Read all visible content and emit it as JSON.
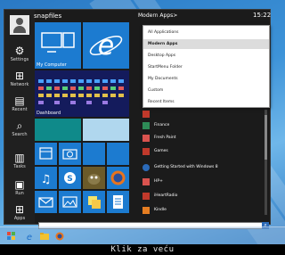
{
  "sidebar": {
    "items": [
      {
        "label": "Settings",
        "icon": "gear-icon"
      },
      {
        "label": "Network",
        "icon": "network-icon"
      },
      {
        "label": "Recent",
        "icon": "recent-icon"
      },
      {
        "label": "Search",
        "icon": "search-icon"
      },
      {
        "label": "Tasks",
        "icon": "tasks-icon"
      },
      {
        "label": "Run",
        "icon": "run-icon"
      },
      {
        "label": "Apps",
        "icon": "apps-icon"
      }
    ]
  },
  "user": {
    "name": "snapfiles"
  },
  "header": {
    "apps_label": "Modern Apps>",
    "clock": "15:22"
  },
  "tiles": {
    "my_computer": "My Computer",
    "dashboard": "Dashboard"
  },
  "dropdown": {
    "items": [
      "All Applications",
      "Modern Apps",
      "Desktop Apps",
      "StartMenu Folder",
      "My Documents",
      "Custom",
      "Recent Items"
    ],
    "selected_index": 1
  },
  "applist": [
    {
      "name": "",
      "color": "#c0392b",
      "icon": "app-icon"
    },
    {
      "name": "Finance",
      "color": "#2e8b57",
      "icon": "finance-icon"
    },
    {
      "name": "Fresh Paint",
      "color": "#d9534f",
      "icon": "fresh-paint-icon"
    },
    {
      "name": "Games",
      "color": "#c0392b",
      "icon": "games-icon"
    },
    {
      "name": "Getting Started with Windows 8",
      "color": "#2b6ab8",
      "icon": "getting-started-icon"
    },
    {
      "name": "HP+",
      "color": "#d9534f",
      "icon": "hp-icon"
    },
    {
      "name": "iHeartRadio",
      "color": "#c0392b",
      "icon": "iheartradio-icon"
    },
    {
      "name": "Kindle",
      "color": "#e67e22",
      "icon": "kindle-icon"
    }
  ],
  "caption": "Klik za veću",
  "colors": {
    "menu_bg": "#1b1b1b",
    "tile_blue": "#1c7bd0",
    "accent": "#2b6ab8"
  }
}
